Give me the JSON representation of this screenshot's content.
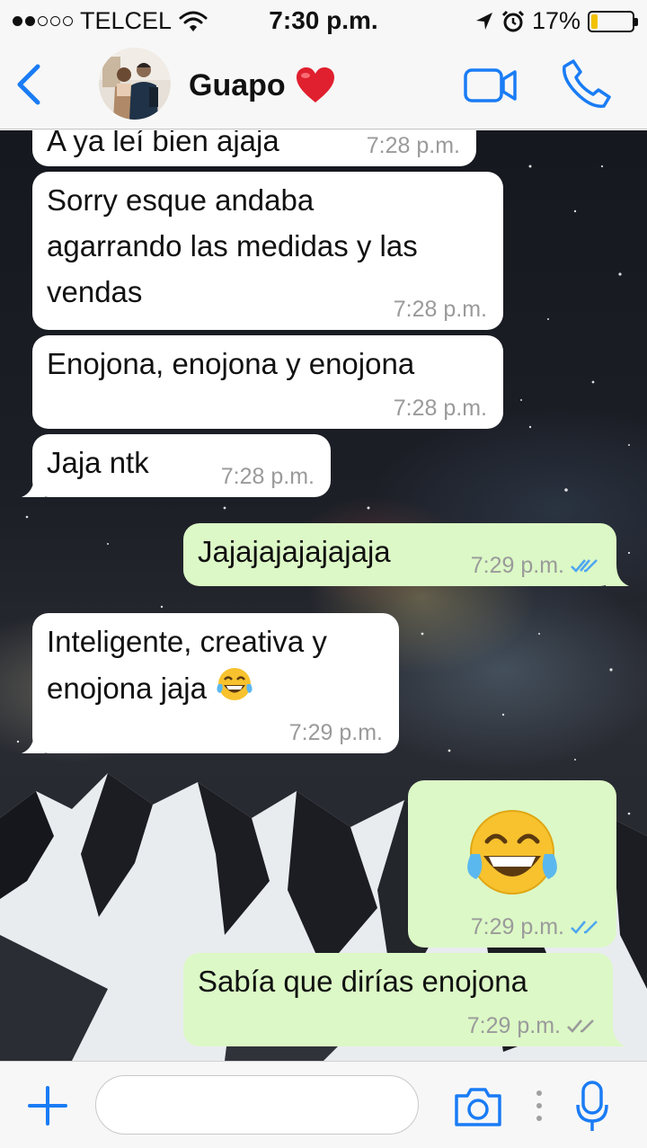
{
  "status_bar": {
    "carrier": "TELCEL",
    "signal_bars_filled": 2,
    "signal_bars_total": 5,
    "time": "7:30 p.m.",
    "battery_percent": "17%",
    "battery_level": 0.17
  },
  "header": {
    "contact_name": "Guapo",
    "icons": [
      "back-chevron-icon",
      "avatar",
      "heart-icon",
      "video-call-icon",
      "phone-icon"
    ]
  },
  "messages": [
    {
      "dir": "in",
      "text": "A ya leí bien ajaja",
      "time": "7:28 p.m."
    },
    {
      "dir": "in",
      "text_lines": [
        "Sorry esque andaba",
        "agarrando las medidas y las",
        "vendas"
      ],
      "time": "7:28 p.m."
    },
    {
      "dir": "in",
      "text": "Enojona, enojona y enojona",
      "time": "7:28 p.m."
    },
    {
      "dir": "in",
      "text": "Jaja ntk",
      "time": "7:28 p.m."
    },
    {
      "dir": "out",
      "text": "Jajajajajajajaja",
      "time": "7:29 p.m.",
      "status": "read"
    },
    {
      "dir": "in",
      "text_lines": [
        "Inteligente, creativa y",
        "enojona jaja"
      ],
      "emoji": "tears-of-joy",
      "time": "7:29 p.m."
    },
    {
      "dir": "out",
      "emoji": "tears-of-joy",
      "time": "7:29 p.m.",
      "status": "read"
    },
    {
      "dir": "out",
      "text": "Sabía que dirías enojona",
      "time": "7:29 p.m.",
      "status": "delivered"
    }
  ],
  "input_bar": {
    "placeholder": "",
    "icons": [
      "plus-icon",
      "camera-icon",
      "more-icon",
      "microphone-icon"
    ]
  },
  "colors": {
    "accent": "#1a7cf5",
    "outgoing_bubble": "#dcf8c6",
    "incoming_bubble": "#ffffff",
    "read_ticks": "#4fa6ef",
    "delivered_ticks": "#9a9a9a",
    "battery": "#f2c200"
  }
}
